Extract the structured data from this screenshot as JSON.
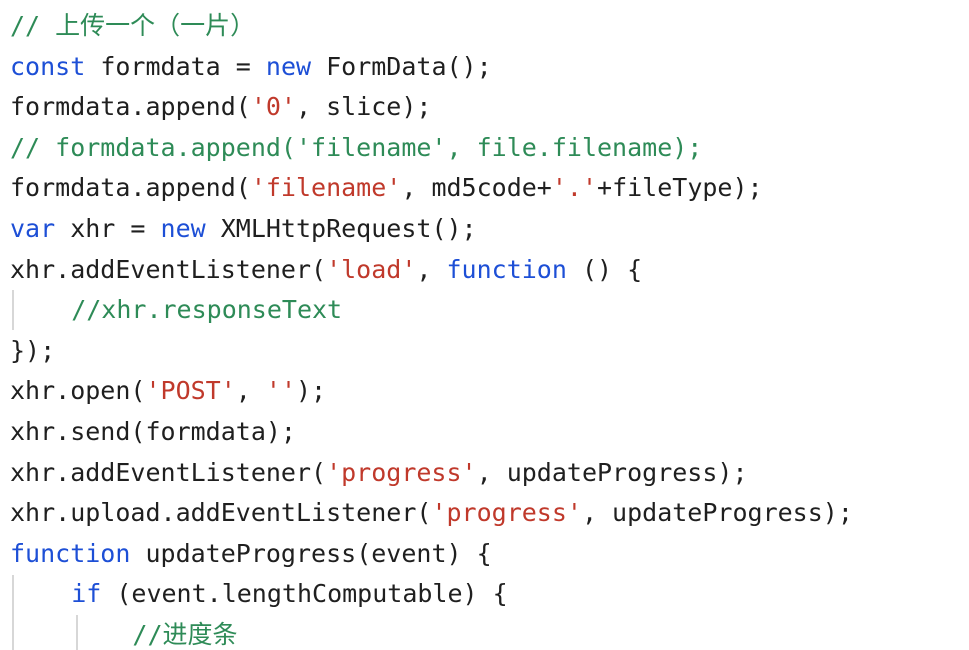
{
  "colors": {
    "background": "#ffffff",
    "default": "#1f1f1f",
    "keyword": "#1d4fd6",
    "string": "#c0392b",
    "comment": "#2e8b57",
    "punct": "#1f1f1f"
  },
  "editor": {
    "lines": [
      {
        "tokens": [
          {
            "text": "// 上传一个（一片）",
            "type": "comment"
          }
        ]
      },
      {
        "tokens": [
          {
            "text": "const",
            "type": "keyword"
          },
          {
            "text": " formdata = ",
            "type": "default"
          },
          {
            "text": "new",
            "type": "keyword"
          },
          {
            "text": " FormData();",
            "type": "default"
          }
        ]
      },
      {
        "tokens": [
          {
            "text": "formdata.append(",
            "type": "default"
          },
          {
            "text": "'0'",
            "type": "string"
          },
          {
            "text": ", slice);",
            "type": "default"
          }
        ]
      },
      {
        "tokens": [
          {
            "text": "// formdata.append('filename', file.filename);",
            "type": "comment"
          }
        ]
      },
      {
        "tokens": [
          {
            "text": "formdata.append(",
            "type": "default"
          },
          {
            "text": "'filename'",
            "type": "string"
          },
          {
            "text": ", md5code+",
            "type": "default"
          },
          {
            "text": "'.'",
            "type": "string"
          },
          {
            "text": "+fileType);",
            "type": "default"
          }
        ]
      },
      {
        "tokens": [
          {
            "text": "var",
            "type": "keyword"
          },
          {
            "text": " xhr = ",
            "type": "default"
          },
          {
            "text": "new",
            "type": "keyword"
          },
          {
            "text": " XMLHttpRequest();",
            "type": "default"
          }
        ]
      },
      {
        "tokens": [
          {
            "text": "xhr.addEventListener(",
            "type": "default"
          },
          {
            "text": "'load'",
            "type": "string"
          },
          {
            "text": ", ",
            "type": "default"
          },
          {
            "text": "function",
            "type": "keyword"
          },
          {
            "text": " () {",
            "type": "default"
          }
        ]
      },
      {
        "indent": 2,
        "tokens": [
          {
            "text": "//xhr.responseText",
            "type": "comment"
          }
        ]
      },
      {
        "tokens": [
          {
            "text": "});",
            "type": "default"
          }
        ]
      },
      {
        "tokens": [
          {
            "text": "xhr.open(",
            "type": "default"
          },
          {
            "text": "'POST'",
            "type": "string"
          },
          {
            "text": ", ",
            "type": "default"
          },
          {
            "text": "''",
            "type": "string"
          },
          {
            "text": ");",
            "type": "default"
          }
        ]
      },
      {
        "tokens": [
          {
            "text": "xhr.send(formdata);",
            "type": "default"
          }
        ]
      },
      {
        "tokens": [
          {
            "text": "xhr.addEventListener(",
            "type": "default"
          },
          {
            "text": "'progress'",
            "type": "string"
          },
          {
            "text": ", updateProgress);",
            "type": "default"
          }
        ]
      },
      {
        "tokens": [
          {
            "text": "xhr.upload.addEventListener(",
            "type": "default"
          },
          {
            "text": "'progress'",
            "type": "string"
          },
          {
            "text": ", updateProgress);",
            "type": "default"
          }
        ]
      },
      {
        "tokens": [
          {
            "text": "function",
            "type": "keyword"
          },
          {
            "text": " updateProgress(event) {",
            "type": "default"
          }
        ]
      },
      {
        "indent": 2,
        "tokens": [
          {
            "text": "if",
            "type": "keyword"
          },
          {
            "text": " (event.lengthComputable) {",
            "type": "default"
          }
        ]
      },
      {
        "indent": 4,
        "tokens": [
          {
            "text": "//进度条",
            "type": "comment"
          }
        ]
      }
    ]
  }
}
